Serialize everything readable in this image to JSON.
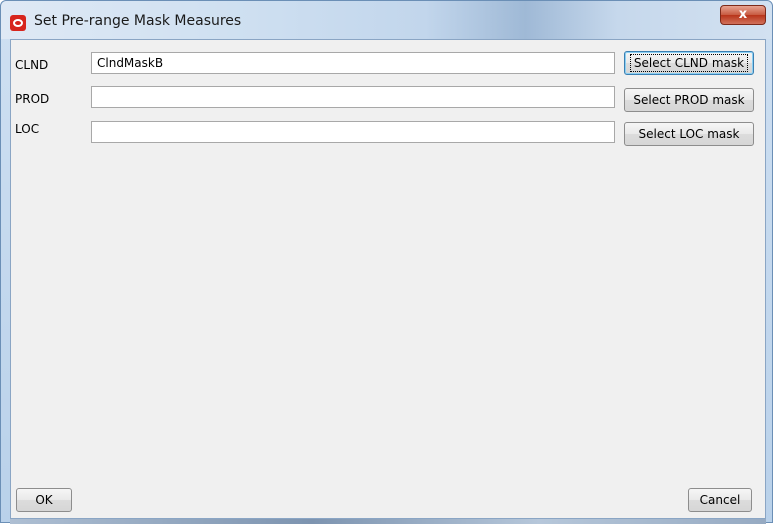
{
  "window": {
    "title": "Set Pre-range Mask Measures",
    "close_label": "x"
  },
  "form": {
    "rows": [
      {
        "label": "CLND",
        "value": "ClndMaskB",
        "button": "Select CLND mask"
      },
      {
        "label": "PROD",
        "value": "",
        "button": "Select PROD mask"
      },
      {
        "label": "LOC",
        "value": "",
        "button": "Select LOC mask"
      }
    ]
  },
  "footer": {
    "ok_label": "OK",
    "cancel_label": "Cancel"
  },
  "colors": {
    "accent_red": "#d7251d",
    "close_red": "#c75a40",
    "client_bg": "#f0f0f0"
  },
  "icons": [
    "oracle-icon",
    "close-icon"
  ]
}
